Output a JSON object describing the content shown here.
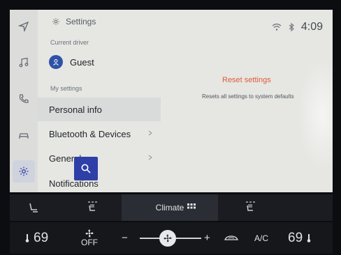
{
  "header": {
    "title": "Settings",
    "time": "4:09"
  },
  "driver": {
    "section_label": "Current driver",
    "name": "Guest"
  },
  "my_settings": {
    "section_label": "My settings",
    "items": [
      {
        "label": "Personal info"
      },
      {
        "label": "Bluetooth & Devices"
      },
      {
        "label": "General"
      },
      {
        "label": "Notifications"
      }
    ]
  },
  "reset": {
    "title": "Reset settings",
    "description": "Resets all settings to system defaults"
  },
  "climate_bar": {
    "climate_label": "Climate",
    "left_temp": "69",
    "right_temp": "69",
    "fan_label": "OFF",
    "ac_label": "A/C",
    "minus": "−",
    "plus": "+"
  },
  "colors": {
    "accent": "#2e3fa8",
    "reset_red": "#e15a3a",
    "avatar": "#2f52a8"
  },
  "icons": [
    "navigation-icon",
    "music-icon",
    "phone-icon",
    "car-icon",
    "gear-icon",
    "search-icon",
    "wifi-icon",
    "bluetooth-icon",
    "seat-recline-icon",
    "seat-heat-left-icon",
    "grid-icon",
    "seat-heat-right-icon",
    "temp-icon",
    "fan-icon",
    "recirculation-icon",
    "chevron-right-icon",
    "user-icon"
  ]
}
